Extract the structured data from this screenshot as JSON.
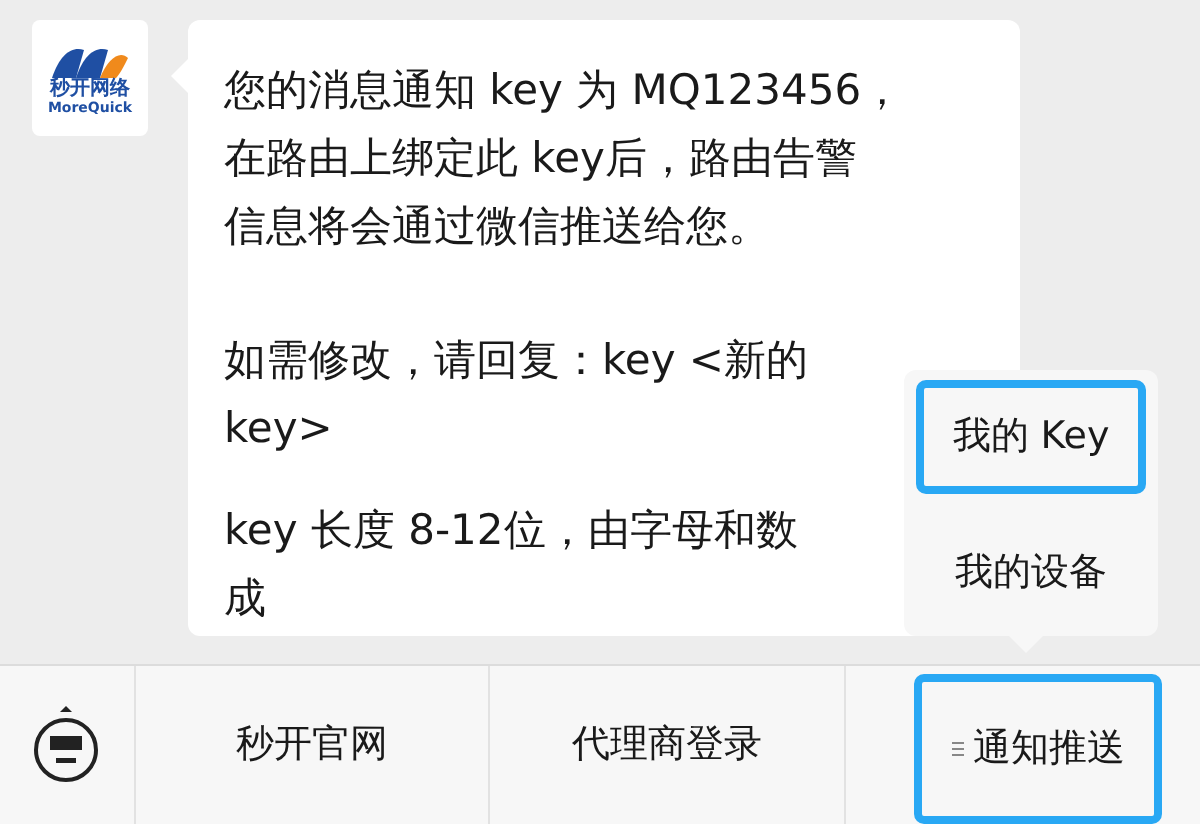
{
  "avatar": {
    "logo_name": "秒开网络",
    "logo_brand": "MoreQuick"
  },
  "message": {
    "paragraphs": [
      {
        "lines": [
          "您的消息通知 key 为 MQ123456，",
          "在路由上绑定此 key后，路由告警",
          "信息将会通过微信推送给您。"
        ]
      },
      {
        "lines": [
          "如需修改，请回复：key <新的",
          "key>"
        ]
      },
      {
        "lines": [
          "key 长度 8-12位，由字母和数",
          "成"
        ]
      }
    ]
  },
  "popup_menu": {
    "items": [
      {
        "label": "我的 Key",
        "selected": true
      },
      {
        "label": "我的设备",
        "selected": false
      }
    ]
  },
  "bottom_menu": {
    "items": [
      {
        "label": "秒开官网",
        "selected": false,
        "has_submenu": false
      },
      {
        "label": "代理商登录",
        "selected": false,
        "has_submenu": false
      },
      {
        "label": "通知推送",
        "selected": true,
        "has_submenu": true
      }
    ]
  }
}
